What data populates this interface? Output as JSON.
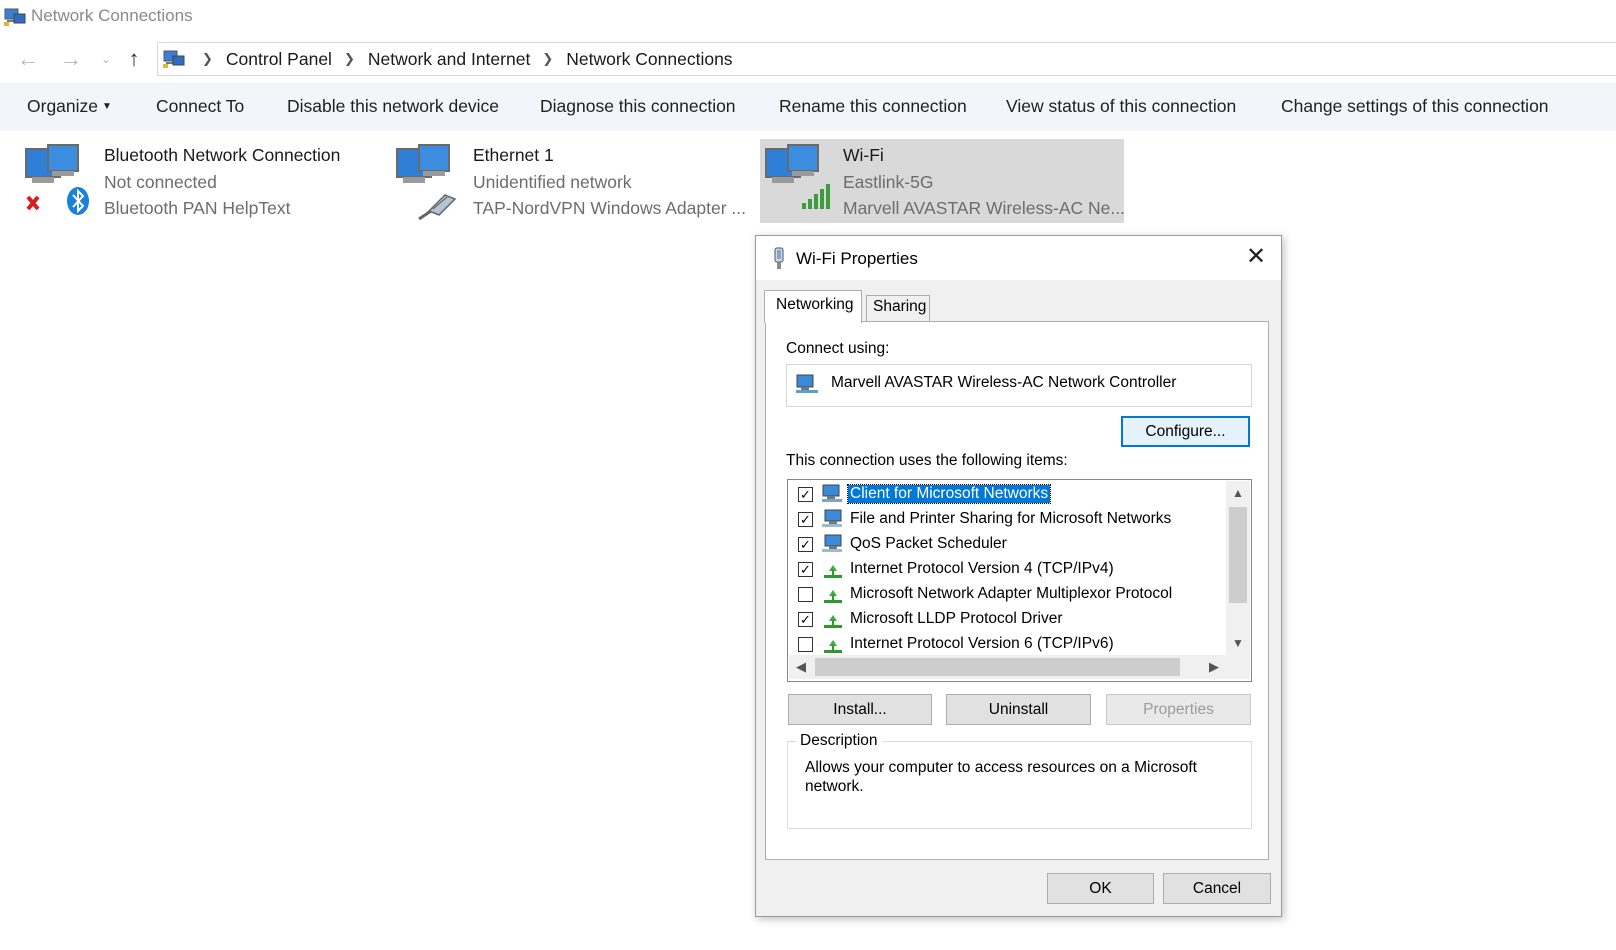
{
  "window": {
    "title": "Network Connections",
    "icon": "network-connections-icon"
  },
  "address_bar": {
    "back_icon": "back-arrow-icon",
    "forward_icon": "forward-arrow-icon",
    "recent_icon": "chevron-down-icon",
    "up_icon": "up-arrow-icon",
    "breadcrumbs": [
      "Control Panel",
      "Network and Internet",
      "Network Connections"
    ]
  },
  "command_bar": {
    "organize": "Organize",
    "connect_to": "Connect To",
    "disable": "Disable this network device",
    "diagnose": "Diagnose this connection",
    "rename": "Rename this connection",
    "view_status": "View status of this connection",
    "change_settings": "Change settings of this connection"
  },
  "connections": [
    {
      "name": "Bluetooth Network Connection",
      "status": "Not connected",
      "adapter": "Bluetooth PAN HelpText",
      "icon": "bluetooth-network-icon"
    },
    {
      "name": "Ethernet 1",
      "status": "Unidentified network",
      "adapter": "TAP-NordVPN Windows Adapter ...",
      "icon": "ethernet-network-icon"
    },
    {
      "name": "Wi-Fi",
      "status": "Eastlink-5G",
      "adapter": "Marvell AVASTAR Wireless-AC Ne...",
      "icon": "wifi-network-icon"
    }
  ],
  "dialog": {
    "title": "Wi-Fi Properties",
    "tabs": [
      "Networking",
      "Sharing"
    ],
    "connect_using_label": "Connect using:",
    "adapter_name": "Marvell AVASTAR Wireless-AC Network Controller",
    "configure_button": "Configure...",
    "items_label": "This connection uses the following items:",
    "items": [
      {
        "label": "Client for Microsoft Networks",
        "checked": true,
        "selected": true,
        "icon": "network-client-icon"
      },
      {
        "label": "File and Printer Sharing for Microsoft Networks",
        "checked": true,
        "selected": false,
        "icon": "network-service-icon"
      },
      {
        "label": "QoS Packet Scheduler",
        "checked": true,
        "selected": false,
        "icon": "network-service-icon"
      },
      {
        "label": "Internet Protocol Version 4 (TCP/IPv4)",
        "checked": true,
        "selected": false,
        "icon": "protocol-icon"
      },
      {
        "label": "Microsoft Network Adapter Multiplexor Protocol",
        "checked": false,
        "selected": false,
        "icon": "protocol-icon"
      },
      {
        "label": "Microsoft LLDP Protocol Driver",
        "checked": true,
        "selected": false,
        "icon": "protocol-icon"
      },
      {
        "label": "Internet Protocol Version 6 (TCP/IPv6)",
        "checked": false,
        "selected": false,
        "icon": "protocol-icon"
      }
    ],
    "install_button": "Install...",
    "uninstall_button": "Uninstall",
    "properties_button": "Properties",
    "description_label": "Description",
    "description_text": "Allows your computer to access resources on a Microsoft network.",
    "ok_button": "OK",
    "cancel_button": "Cancel"
  },
  "colors": {
    "selection": "#0078d7",
    "command_bar_bg": "#f2f5f9",
    "selected_tile_bg": "#d9d9d9"
  }
}
